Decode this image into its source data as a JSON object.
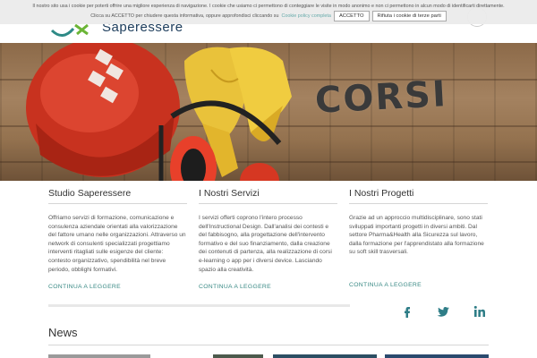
{
  "header": {
    "logo_text": "Saperessere"
  },
  "cookie_bar": {
    "line1": "Il nostro sito usa i cookie per poterti offrire una migliore esperienza di navigazione. I cookie che usiamo ci permettono di conteggiare le visite in modo anonimo e non ci permettono in alcun modo di identificarti direttamente.",
    "line2": "Clicca su ACCETTO per chiudere questa informativa, oppure approfondisci cliccando su",
    "policy_link": "Cookie policy completa",
    "accept_label": "ACCETTO",
    "refuse_label": "Rifiuta i cookie di terze parti"
  },
  "hero": {
    "title": "CORSI"
  },
  "columns": [
    {
      "title": "Studio Saperessere",
      "text": "Offriamo servizi di formazione, comunicazione e consulenza aziendale orientati alla valorizzazione del fattore umano nelle organizzazioni. Attraverso un network di consulenti specializzati progettiamo interventi ritagliati sulle esigenze del cliente: contesto organizzativo, spendibilità nel breve periodo, obblighi formativi.",
      "link": "CONTINUA A LEGGERE"
    },
    {
      "title": "I Nostri Servizi",
      "text": "I servizi offerti coprono l'intero processo dell'Instructional Design. Dall'analisi dei contesti e del fabbisogno, alla progettazione dell'intervento formativo e del suo finanziamento, dalla creazione dei contenuti di partenza, alla realizzazione di corsi e-learning o app per i diversi device. Lasciando spazio alla creatività.",
      "link": "CONTINUA A LEGGERE"
    },
    {
      "title": "I Nostri Progetti",
      "text": "Grazie ad un approccio multidisciplinare, sono stati sviluppati importanti progetti in diversi ambiti. Dal settore Pharma&Health alla Sicurezza sul lavoro, dalla formazione per l'apprendistato alla formazione su soft skill trasversali.",
      "link": "CONTINUA A LEGGERE"
    }
  ],
  "social": {
    "facebook": "facebook-icon",
    "twitter": "twitter-icon",
    "linkedin": "linkedin-icon",
    "color": "#2e7d87"
  },
  "news": {
    "title": "News"
  }
}
